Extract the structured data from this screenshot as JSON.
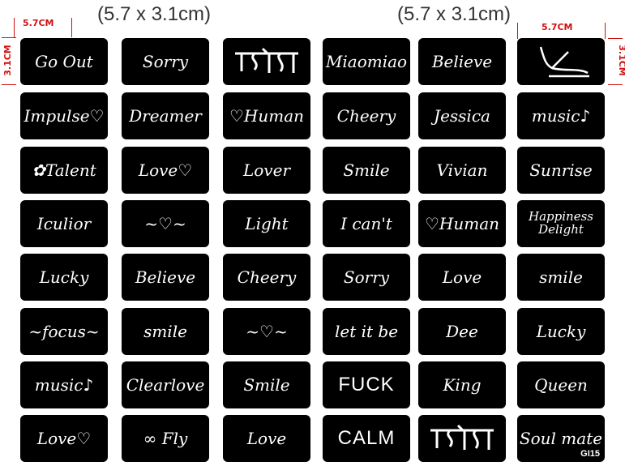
{
  "size_labels": {
    "left": "(5.7 x 3.1cm)",
    "right": "(5.7 x 3.1cm)"
  },
  "dimensions": {
    "width": "5.7CM",
    "height": "3.1CM"
  },
  "product_code": "GI15",
  "colors": {
    "stencil": "#000000",
    "lettering": "#ffffff",
    "dimension": "#d01010"
  },
  "stencils": [
    [
      "Go Out",
      "Sorry",
      "[Tibetan script]",
      "Miaomiao",
      "Believe",
      "[bird]"
    ],
    [
      "Impulse♡",
      "Dreamer",
      "♡Human",
      "Cheery",
      "Jessica",
      "music♪"
    ],
    [
      "✿Talent",
      "Love♡",
      "Lover",
      "Smile",
      "Vivian",
      "Sunrise"
    ],
    [
      "Iculior",
      "~♡~",
      "Light",
      "I can't",
      "♡Human",
      "Happiness Delight"
    ],
    [
      "Lucky",
      "Believe",
      "Cheery",
      "Sorry",
      "Love",
      "smile"
    ],
    [
      "~focus~",
      "smile",
      "~♡~",
      "let it be",
      "Dee",
      "Lucky"
    ],
    [
      "music♪",
      "Clearlove",
      "Smile",
      "FUCK",
      "King",
      "Queen"
    ],
    [
      "Love♡",
      "∞ Fly",
      "Love",
      "CALM",
      "[Tibetan script]",
      "Soul mate"
    ]
  ]
}
